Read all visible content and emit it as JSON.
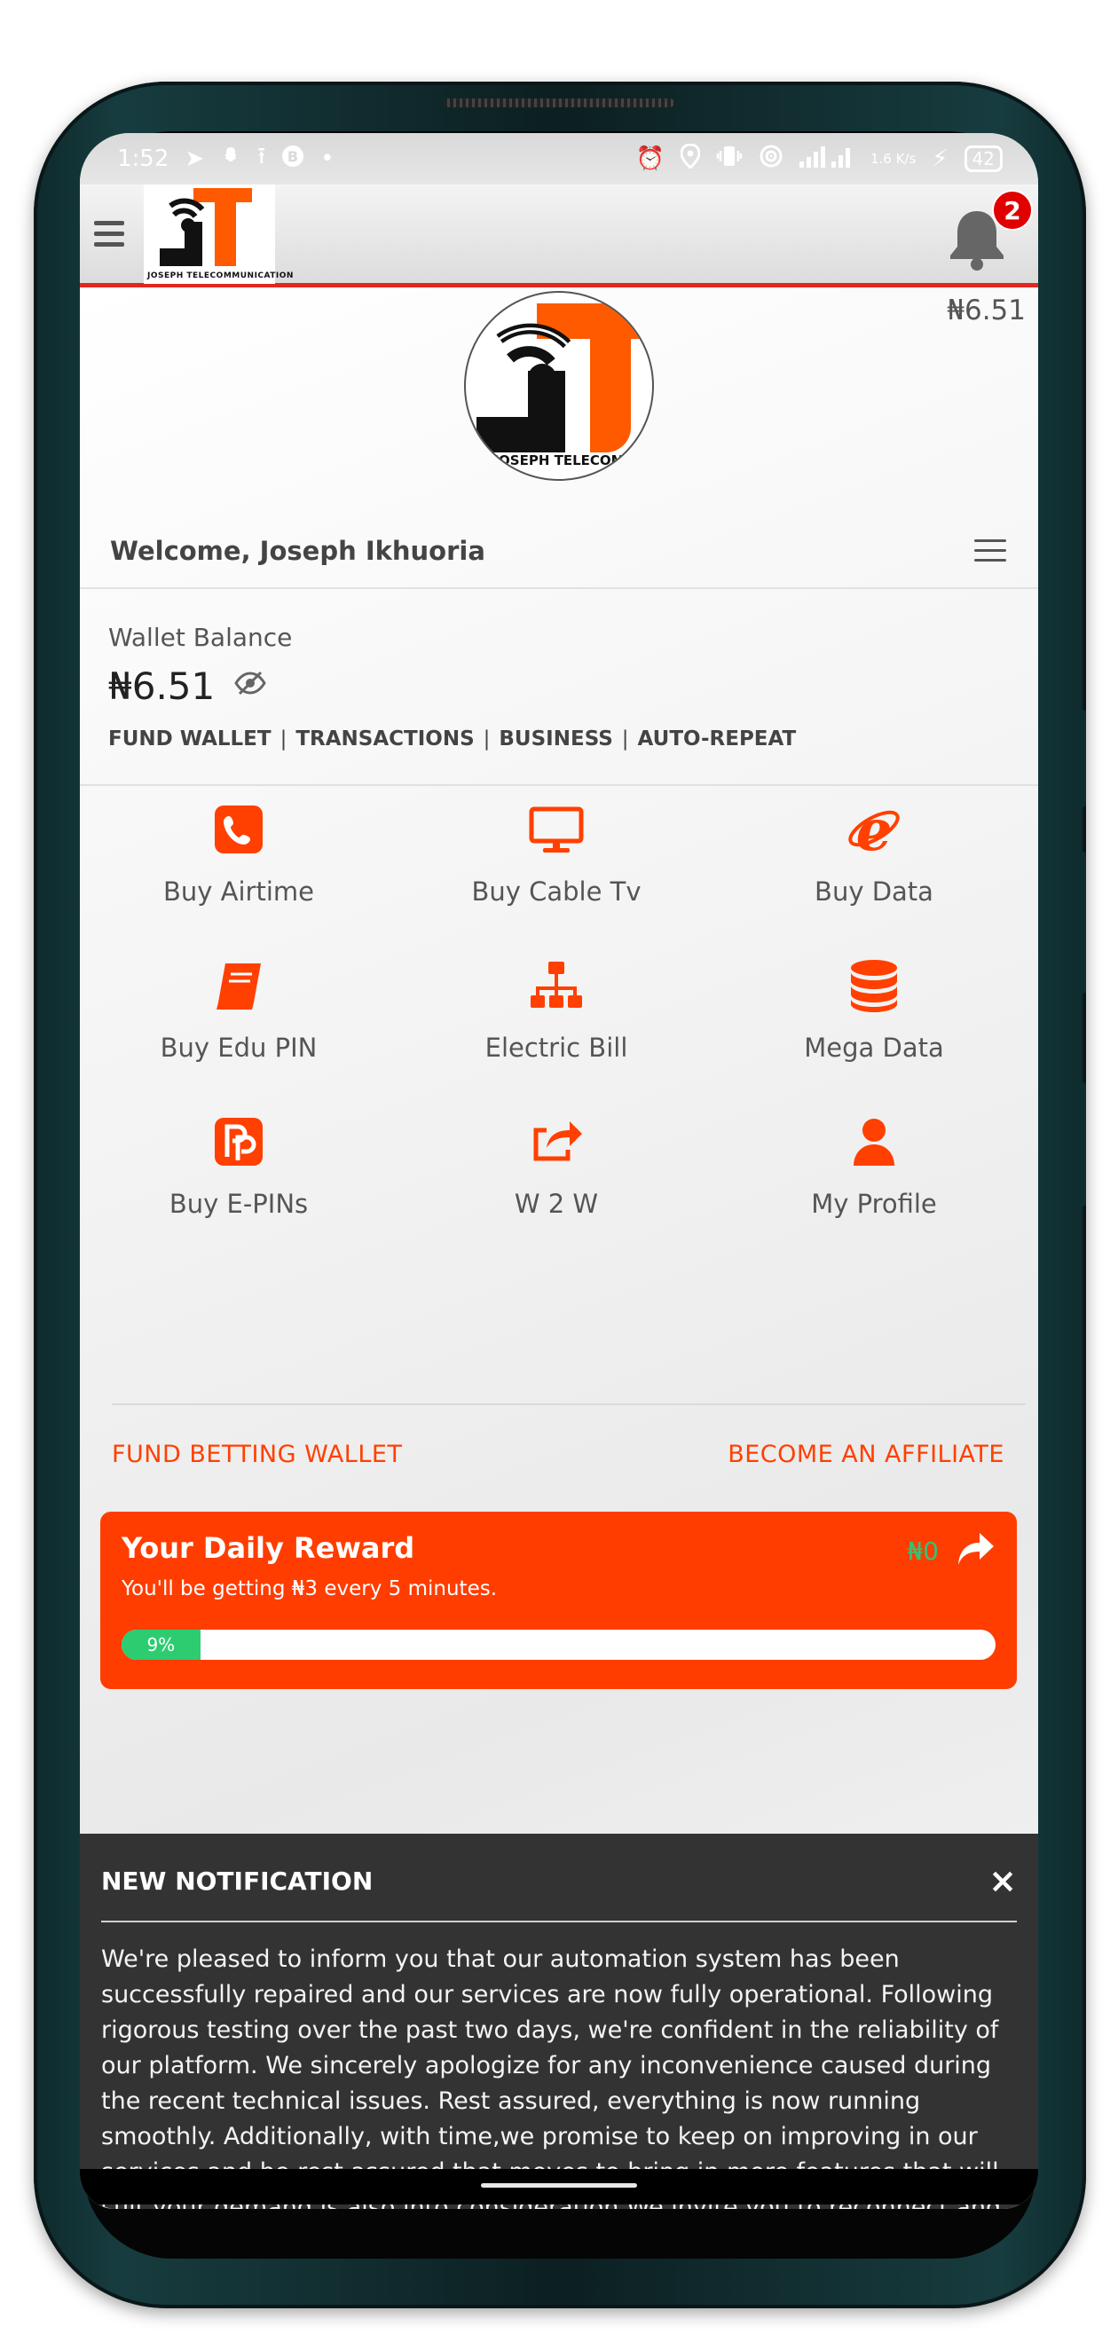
{
  "status_bar": {
    "time": "1:52",
    "left_icons": [
      "telegram-icon",
      "snapchat-icon",
      "upload-icon",
      "bitcoin-icon",
      "dot-icon"
    ],
    "right_icons": [
      "alarm-icon",
      "location-icon",
      "vibrate-icon",
      "hotspot-icon",
      "signal-icon"
    ],
    "network_speed": "1.6 K/s",
    "battery": "42"
  },
  "app_bar": {
    "logo_caption": "JOSEPH TELECOMMUNICATION",
    "notification_count": "2"
  },
  "header": {
    "balance_top": "₦6.51",
    "logo_caption": "JOSEPH TELECOM",
    "welcome": "Welcome, Joseph Ikhuoria"
  },
  "wallet": {
    "label": "Wallet Balance",
    "amount": "₦6.51",
    "links": [
      "FUND WALLET",
      "TRANSACTIONS",
      "BUSINESS",
      "AUTO-REPEAT"
    ]
  },
  "services": [
    {
      "label": "Buy Airtime",
      "icon": "phone-icon"
    },
    {
      "label": "Buy Cable Tv",
      "icon": "monitor-icon"
    },
    {
      "label": "Buy Data",
      "icon": "internet-explorer-icon"
    },
    {
      "label": "Buy Edu PIN",
      "icon": "book-icon"
    },
    {
      "label": "Electric Bill",
      "icon": "sitemap-icon"
    },
    {
      "label": "Mega Data",
      "icon": "database-icon"
    },
    {
      "label": "Buy E-PINs",
      "icon": "pp-icon"
    },
    {
      "label": "W 2 W",
      "icon": "share-square-icon"
    },
    {
      "label": "My Profile",
      "icon": "user-icon"
    }
  ],
  "links": {
    "fund_betting": "FUND BETTING WALLET",
    "affiliate": "BECOME AN AFFILIATE"
  },
  "reward": {
    "title": "Your Daily Reward",
    "amount": "₦0",
    "subtitle": "You'll be getting ₦3 every 5 minutes.",
    "progress_label": "9%",
    "progress_fraction": 0.09
  },
  "notification": {
    "title": "NEW NOTIFICATION",
    "close": "×",
    "body": "We're pleased to inform you that our automation system has been successfully repaired and our services are now fully operational. Following rigorous testing over the past two days, we're confident in the reliability of our platform. We sincerely apologize for any inconvenience caused during the recent technical issues. Rest assured, everything is now running smoothly. Additionally, with time,we promise to keep on improving in our services and be rest assured that moves to bring in more features that will suit your demand is also into consideration.We invite you to reconnect and enjoy our services once again. Thank you for your patience and understanding. Thank you for choosing JOSEPH TELECOM."
  },
  "colors": {
    "accent": "#ff3d00",
    "header_line": "#e3261e",
    "progress": "#2ecc71",
    "reward_amount": "#38c172",
    "notification_bg": "#333333"
  }
}
